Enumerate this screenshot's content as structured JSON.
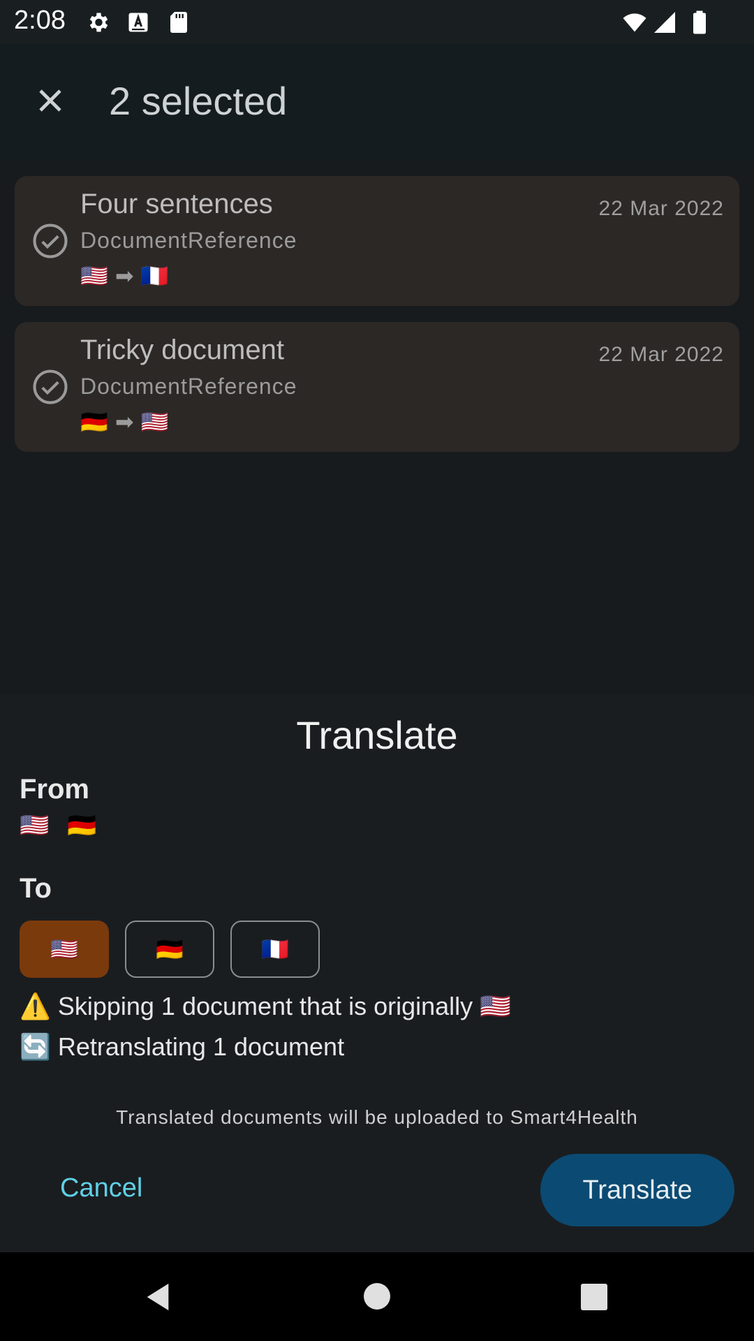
{
  "status_bar": {
    "time": "2:08",
    "icons": [
      "gear-icon",
      "font-a-icon",
      "sd-card-icon",
      "wifi-icon",
      "signal-icon",
      "battery-icon"
    ]
  },
  "app_bar": {
    "close_icon": "close-icon",
    "title": "2 selected"
  },
  "documents": [
    {
      "title": "Four sentences",
      "type": "DocumentReference",
      "date": "22 Mar 2022",
      "from_flag": "🇺🇸",
      "arrow": "➡",
      "to_flag": "🇫🇷",
      "selected": true
    },
    {
      "title": "Tricky document",
      "type": "DocumentReference",
      "date": "22 Mar 2022",
      "from_flag": "🇩🇪",
      "arrow": "➡",
      "to_flag": "🇺🇸",
      "selected": true
    }
  ],
  "sheet": {
    "title": "Translate",
    "from_label": "From",
    "from_flags": [
      "🇺🇸",
      "🇩🇪"
    ],
    "to_label": "To",
    "to_options": [
      {
        "flag": "🇺🇸",
        "selected": true
      },
      {
        "flag": "🇩🇪",
        "selected": false
      },
      {
        "flag": "🇫🇷",
        "selected": false
      }
    ],
    "warning_icon": "⚠️",
    "warning_text": "Skipping 1 document that is originally",
    "warning_flag": "🇺🇸",
    "retranslate_icon": "🔄",
    "retranslate_text": "Retranslating 1 document",
    "upload_note": "Translated documents will be uploaded to Smart4Health",
    "cancel_label": "Cancel",
    "translate_label": "Translate"
  },
  "colors": {
    "accent_cancel": "#5fd0e6",
    "translate_button": "#0b4a72",
    "selected_lang": "#7a3a0b"
  }
}
